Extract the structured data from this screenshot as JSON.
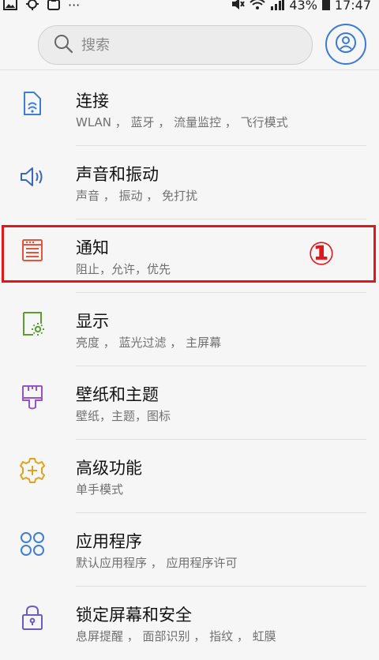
{
  "status_bar": {
    "left_icons": [
      "image-icon",
      "sync-icon",
      "clipboard-icon",
      "more-icon"
    ],
    "right_icons": [
      "mute-icon",
      "wifi-icon",
      "signal-icon",
      "battery-icon"
    ],
    "battery": "43%",
    "time": "17:47"
  },
  "search": {
    "placeholder": "搜索"
  },
  "settings": [
    {
      "title": "连接",
      "subtitle": "WLAN ， 蓝牙 ， 流量监控 ， 飞行模式",
      "icon": "connection-icon",
      "color": "#3b7fd4"
    },
    {
      "title": "声音和振动",
      "subtitle": "声音 ， 振动 ， 免打扰",
      "icon": "speaker-icon",
      "color": "#3b64c8"
    },
    {
      "title": "通知",
      "subtitle": "阻止，允许，优先",
      "icon": "notification-icon",
      "color": "#e4553c"
    },
    {
      "title": "显示",
      "subtitle": "亮度 ， 蓝光过滤 ， 主屏幕",
      "icon": "display-icon",
      "color": "#5aa030"
    },
    {
      "title": "壁纸和主题",
      "subtitle": "壁纸，主题，图标",
      "icon": "brush-icon",
      "color": "#9b52c6"
    },
    {
      "title": "高级功能",
      "subtitle": "单手模式",
      "icon": "advanced-gear-icon",
      "color": "#e2a21d"
    },
    {
      "title": "应用程序",
      "subtitle": "默认应用程序 ， 应用程序许可",
      "icon": "apps-icon",
      "color": "#3f7fd6"
    },
    {
      "title": "锁定屏幕和安全",
      "subtitle": "息屏提醒 ， 面部识别 ， 指纹 ， 虹膜",
      "icon": "lock-icon",
      "color": "#6f58c8"
    }
  ],
  "annotation": {
    "step": "①",
    "color": "#e3161b"
  }
}
